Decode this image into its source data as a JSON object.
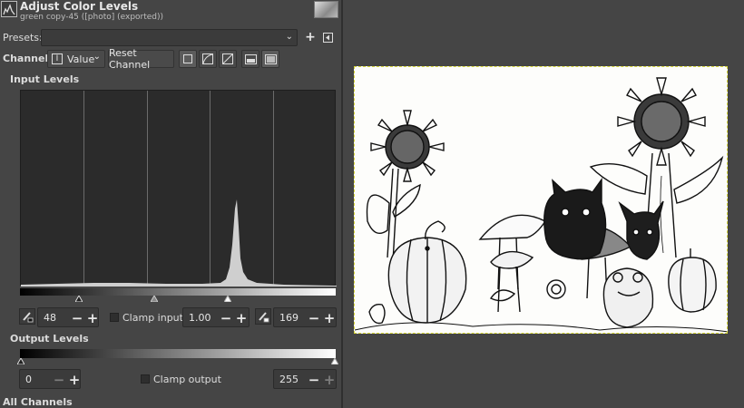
{
  "header": {
    "title": "Adjust Color Levels",
    "subtitle": "green copy-45 ([photo] (exported))"
  },
  "presets": {
    "label": "Presets:",
    "value": ""
  },
  "channel": {
    "label": "Channel:",
    "selected": "Value",
    "reset_label": "Reset Channel"
  },
  "input_levels": {
    "heading": "Input Levels",
    "low": "48",
    "gamma": "1.00",
    "high": "169",
    "clamp_label": "Clamp input"
  },
  "output_levels": {
    "heading": "Output Levels",
    "low": "0",
    "high": "255",
    "clamp_label": "Clamp output"
  },
  "footer": {
    "all_channels": "All Channels"
  },
  "icons": {
    "plus": "+",
    "minus": "−",
    "chevron": "⌄",
    "channel_letter": "I"
  }
}
